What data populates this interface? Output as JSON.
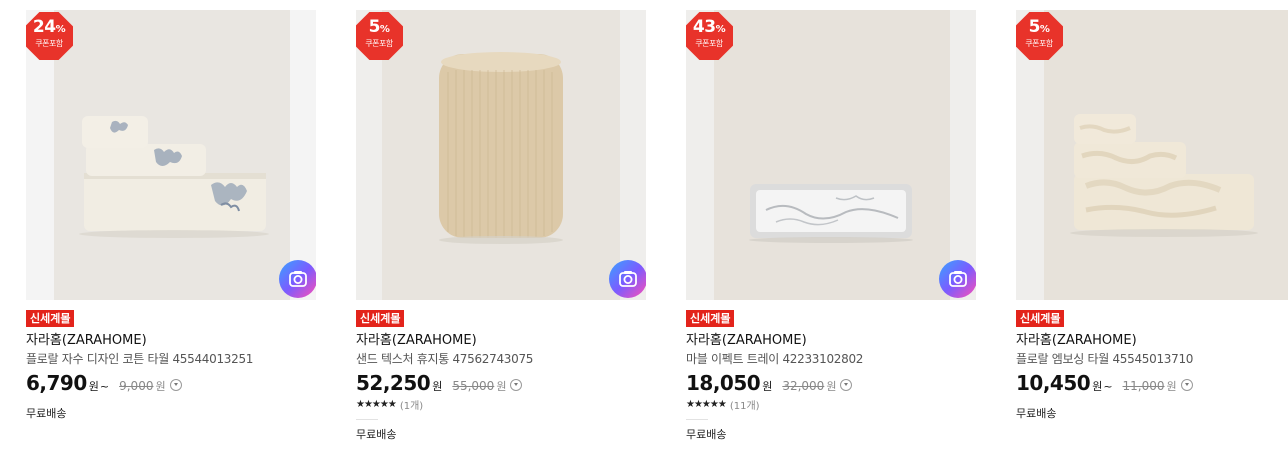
{
  "products": [
    {
      "discount": "24",
      "discount_unit": "%",
      "coupon_label": "쿠폰포함",
      "tag": "신세계몰",
      "brand": "자라홈(ZARAHOME)",
      "name": "플로랄 자수 디자인 코튼 타월 45544013251",
      "price": "6,790",
      "price_unit": "원",
      "price_tilde": "~",
      "original_price": "9,000",
      "original_unit": "원",
      "shipping": "무료배송",
      "image_icon": "towel-stack-image",
      "camera_icon": "camera-icon"
    },
    {
      "discount": "5",
      "discount_unit": "%",
      "coupon_label": "쿠폰포함",
      "tag": "신세계몰",
      "brand": "자라홈(ZARAHOME)",
      "name": "샌드 텍스처 휴지통 47562743075",
      "price": "52,250",
      "price_unit": "원",
      "original_price": "55,000",
      "original_unit": "원",
      "stars": "★★★★★",
      "rating": 5,
      "review_count": "(1개)",
      "shipping": "무료배송",
      "image_icon": "wastebasket-image",
      "camera_icon": "camera-icon"
    },
    {
      "discount": "43",
      "discount_unit": "%",
      "coupon_label": "쿠폰포함",
      "tag": "신세계몰",
      "brand": "자라홈(ZARAHOME)",
      "name": "마블 이펙트 트레이 42233102802",
      "price": "18,050",
      "price_unit": "원",
      "original_price": "32,000",
      "original_unit": "원",
      "stars": "★★★★★",
      "rating": 4.5,
      "review_count": "(11개)",
      "shipping": "무료배송",
      "image_icon": "marble-tray-image",
      "camera_icon": "camera-icon"
    },
    {
      "discount": "5",
      "discount_unit": "%",
      "coupon_label": "쿠폰포함",
      "tag": "신세계몰",
      "brand": "자라홈(ZARAHOME)",
      "name": "플로랄 엠보싱 타월 45545013710",
      "price": "10,450",
      "price_unit": "원",
      "price_tilde": "~",
      "original_price": "11,000",
      "original_unit": "원",
      "shipping": "무료배송",
      "image_icon": "towel-stack-image"
    }
  ],
  "colors": {
    "badge": "#e8332a",
    "tag": "#e3241b"
  }
}
